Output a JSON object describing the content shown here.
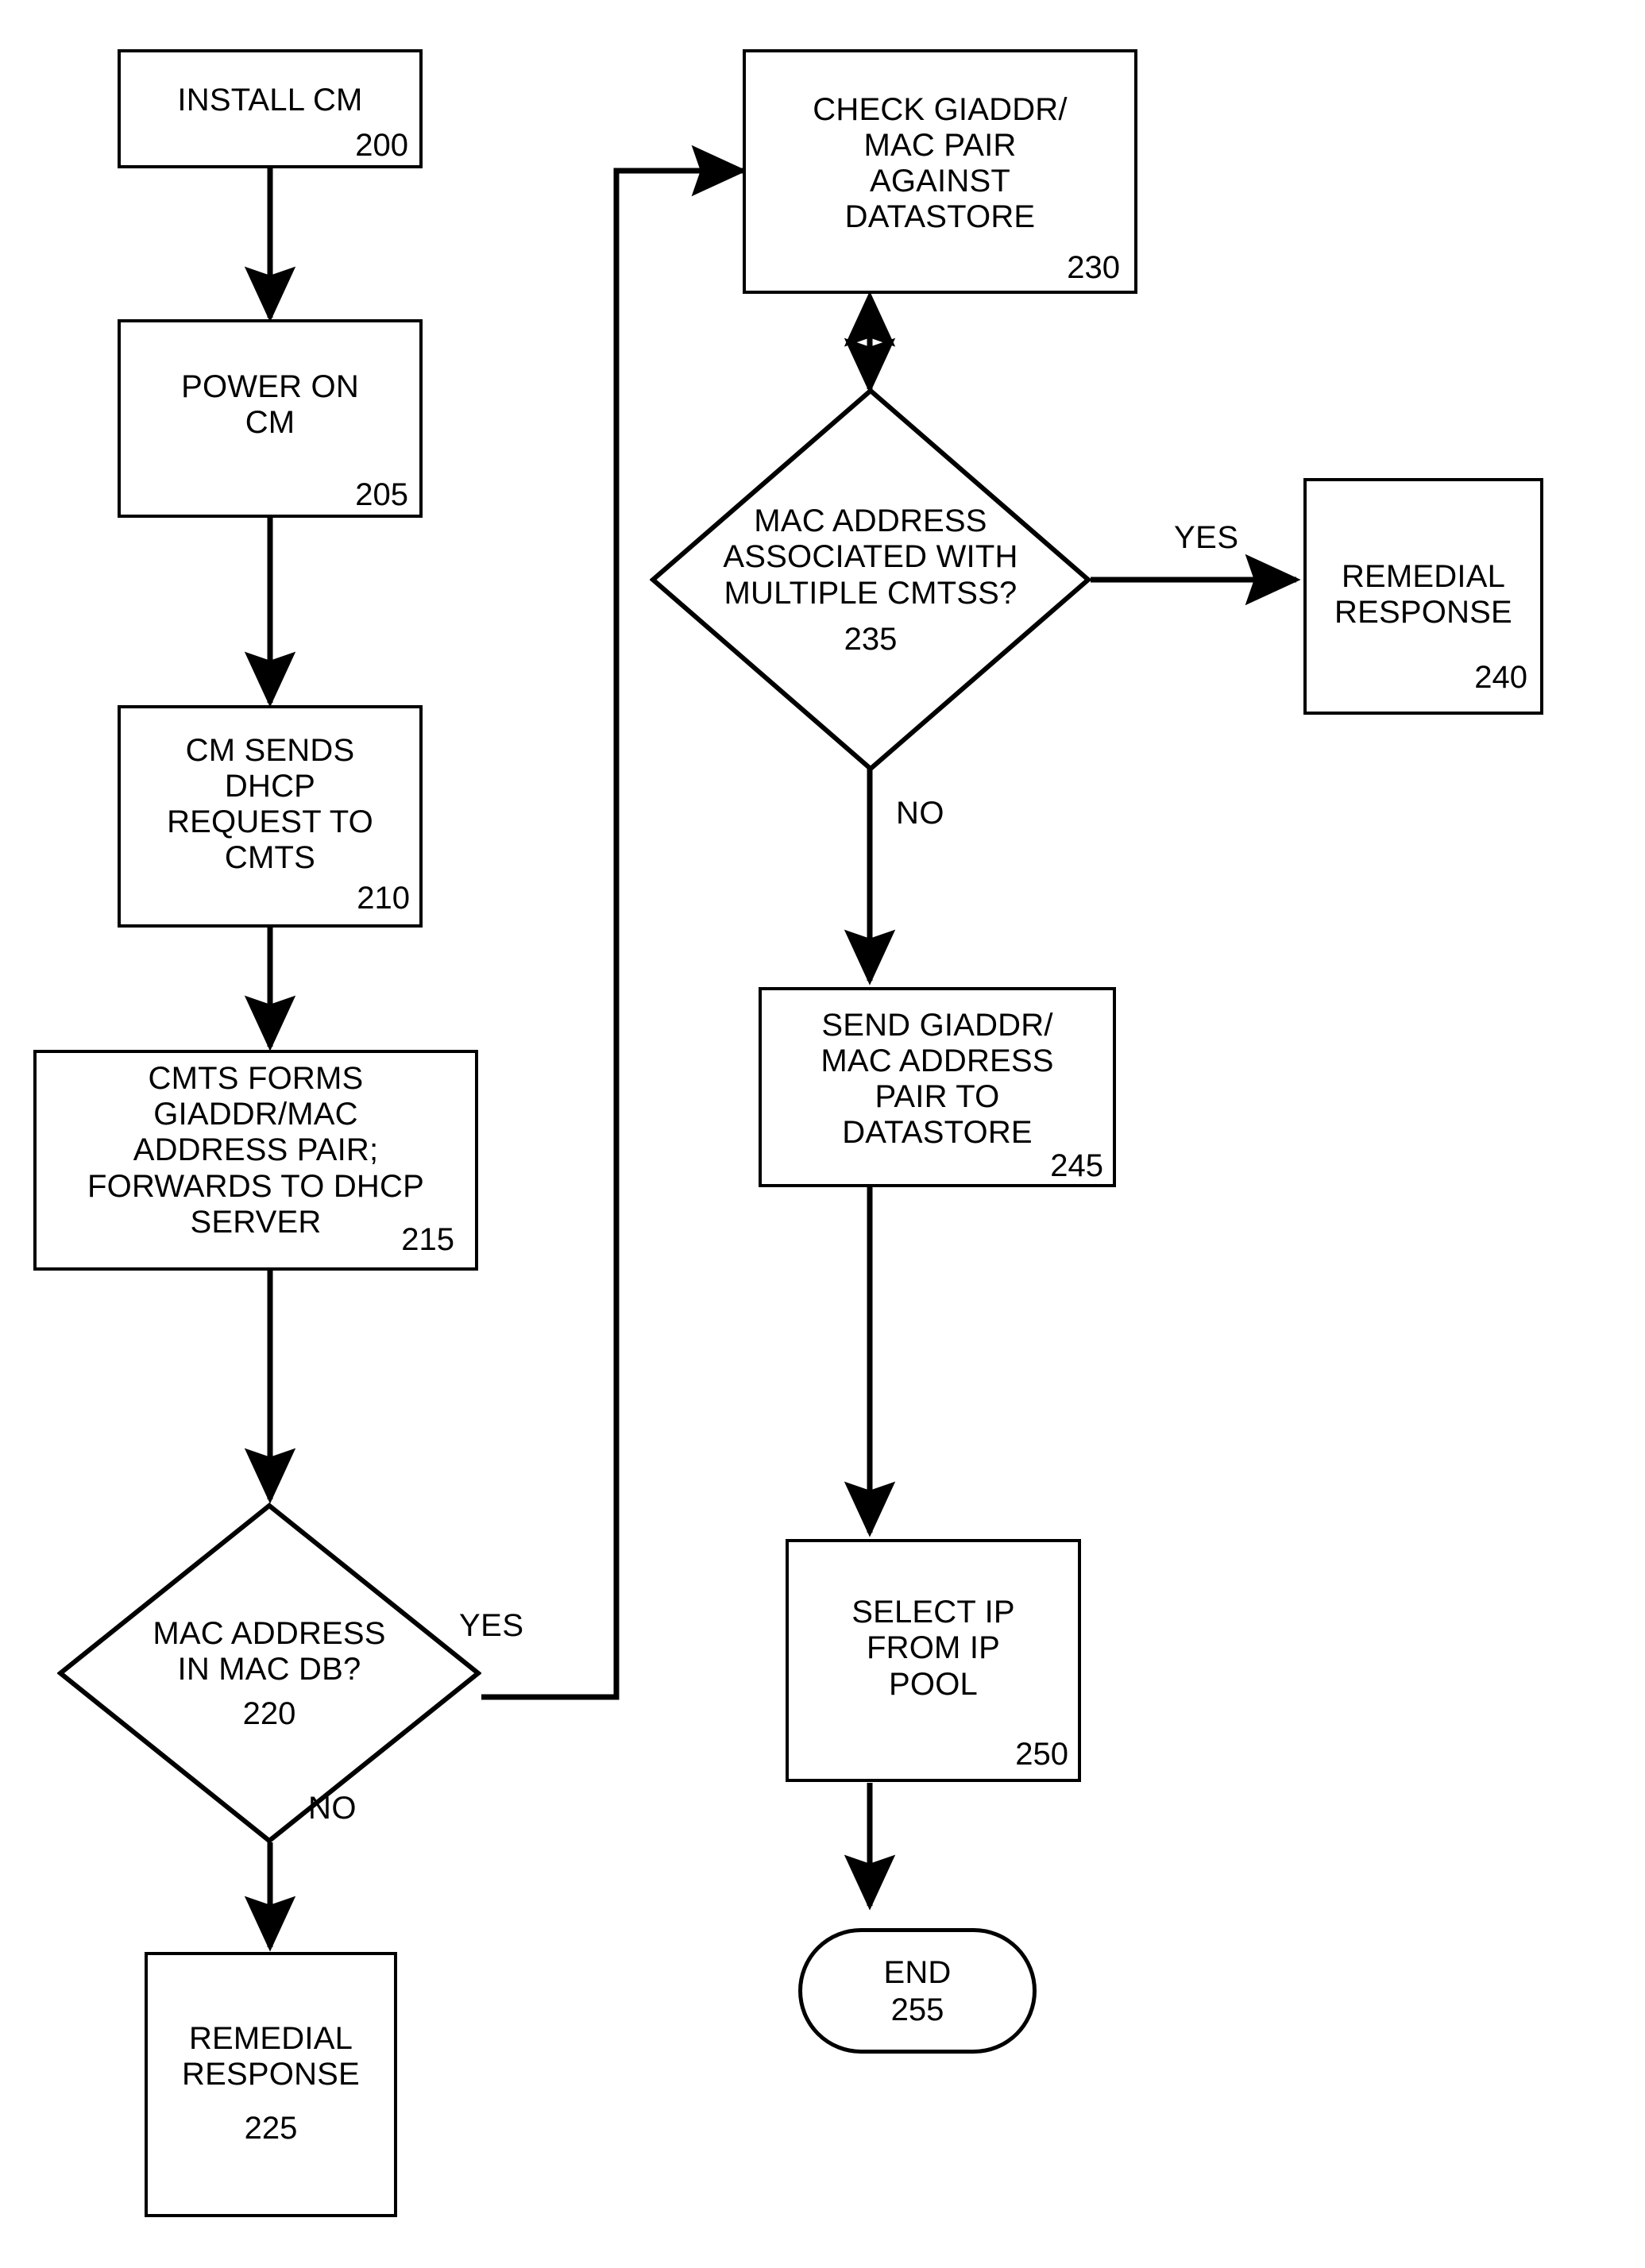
{
  "diagram": {
    "type": "flowchart",
    "title": "",
    "background_color": "#ffffff",
    "line_color": "#000000",
    "text_color": "#000000"
  },
  "nodes": {
    "install_cm": {
      "shape": "process",
      "text": "INSTALL CM",
      "ref": "200"
    },
    "power_on_cm": {
      "shape": "process",
      "text": "POWER ON\nCM",
      "ref": "205"
    },
    "cm_sends_dhcp": {
      "shape": "process",
      "text": "CM SENDS\nDHCP\nREQUEST TO\nCMTS",
      "ref": "210"
    },
    "cmts_forms_pair": {
      "shape": "process",
      "text": "CMTS FORMS\nGIADDR/MAC\nADDRESS PAIR;\nFORWARDS TO DHCP\nSERVER",
      "ref": "215"
    },
    "mac_in_db": {
      "shape": "decision",
      "text": "MAC ADDRESS\nIN MAC DB?",
      "ref": "220"
    },
    "remedial_response_225": {
      "shape": "process",
      "text": "REMEDIAL\nRESPONSE",
      "ref": "225"
    },
    "check_pair_datastore": {
      "shape": "process",
      "text": "CHECK GIADDR/\nMAC PAIR\nAGAINST\nDATASTORE",
      "ref": "230"
    },
    "multiple_cmts": {
      "shape": "decision",
      "text": "MAC ADDRESS\nASSOCIATED WITH\nMULTIPLE CMTSs?",
      "ref": "235"
    },
    "remedial_response_240": {
      "shape": "process",
      "text": "REMEDIAL\nRESPONSE",
      "ref": "240"
    },
    "send_pair_datastore": {
      "shape": "process",
      "text": "SEND GIADDR/\nMAC ADDRESS\nPAIR TO\nDATASTORE",
      "ref": "245"
    },
    "select_ip": {
      "shape": "process",
      "text": "SELECT IP\nFROM IP\nPOOL",
      "ref": "250"
    },
    "end": {
      "shape": "terminator",
      "text": "END",
      "ref": "255"
    }
  },
  "edge_labels": {
    "yes_220": "YES",
    "no_220": "NO",
    "yes_235": "YES",
    "no_235": "NO"
  },
  "edges": [
    {
      "from": "install_cm",
      "to": "power_on_cm",
      "label": ""
    },
    {
      "from": "power_on_cm",
      "to": "cm_sends_dhcp",
      "label": ""
    },
    {
      "from": "cm_sends_dhcp",
      "to": "cmts_forms_pair",
      "label": ""
    },
    {
      "from": "cmts_forms_pair",
      "to": "mac_in_db",
      "label": ""
    },
    {
      "from": "mac_in_db",
      "to": "check_pair_datastore",
      "label": "YES"
    },
    {
      "from": "mac_in_db",
      "to": "remedial_response_225",
      "label": "NO"
    },
    {
      "from": "check_pair_datastore",
      "to": "multiple_cmts",
      "label": "",
      "bidirectional": true
    },
    {
      "from": "multiple_cmts",
      "to": "remedial_response_240",
      "label": "YES"
    },
    {
      "from": "multiple_cmts",
      "to": "send_pair_datastore",
      "label": "NO"
    },
    {
      "from": "send_pair_datastore",
      "to": "select_ip",
      "label": ""
    },
    {
      "from": "select_ip",
      "to": "end",
      "label": ""
    }
  ]
}
